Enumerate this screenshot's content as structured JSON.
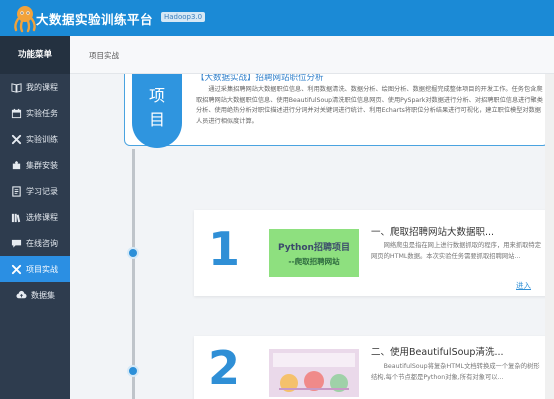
{
  "header": {
    "title": "大数据实验训练平台",
    "version": "Hadoop3.0"
  },
  "sidebar": {
    "heading": "功能菜单",
    "items": [
      {
        "label": "我的课程",
        "icon": "book-icon"
      },
      {
        "label": "实验任务",
        "icon": "calendar-icon"
      },
      {
        "label": "实验训练",
        "icon": "tools-icon"
      },
      {
        "label": "集群安装",
        "icon": "puzzle-icon"
      },
      {
        "label": "学习记录",
        "icon": "document-icon"
      },
      {
        "label": "选修课程",
        "icon": "books-icon"
      },
      {
        "label": "在线咨询",
        "icon": "chat-icon"
      },
      {
        "label": "项目实战",
        "icon": "tools-icon",
        "active": true
      },
      {
        "label": "数据集",
        "icon": "cloud-upload-icon"
      }
    ]
  },
  "breadcrumb": "项目实战",
  "project": {
    "tab_label_top": "项",
    "tab_label_bottom": "目",
    "title": "【大数据实战】招聘网站职位分析",
    "description": "通过采集招聘网站大数据职位信息、利用数据清洗、数据分析、绘图分析、数据挖掘完成整体项目的开发工作。任务包含爬取招聘网站大数据职位信息、使用BeautifulSoup清洗职位信息网页、使用PySpark对数据进行分析、对招聘职位信息进行聚类分析、使用绝热分析对职位描述进行分词并对关键词进行统计、利用Echarts将职位分析结果进行可视化，建立职位模型对数据人员进行相似度计算。"
  },
  "steps": [
    {
      "number": "1",
      "thumb_line1": "Python招聘项目",
      "thumb_line2": "--爬取招聘网站",
      "title": "一、爬取招聘网站大数据职...",
      "description": "网络爬虫是指在网上进行数据抓取的程序，用来抓取特定网页的HTML数据。本次实验任务需要抓取招聘网站...",
      "link": "进入"
    },
    {
      "number": "2",
      "title": "二、使用BeautifulSoup清洗...",
      "description": "BeautifulSoup将复杂HTML文档转换成一个复杂的树形结构,每个节点都是Python对象,所有对象可以..."
    }
  ],
  "colors": {
    "header": "#1b8ad6",
    "sidebar": "#2e3c4e",
    "active": "#2b8fe3",
    "accent": "#2f8fd6"
  }
}
